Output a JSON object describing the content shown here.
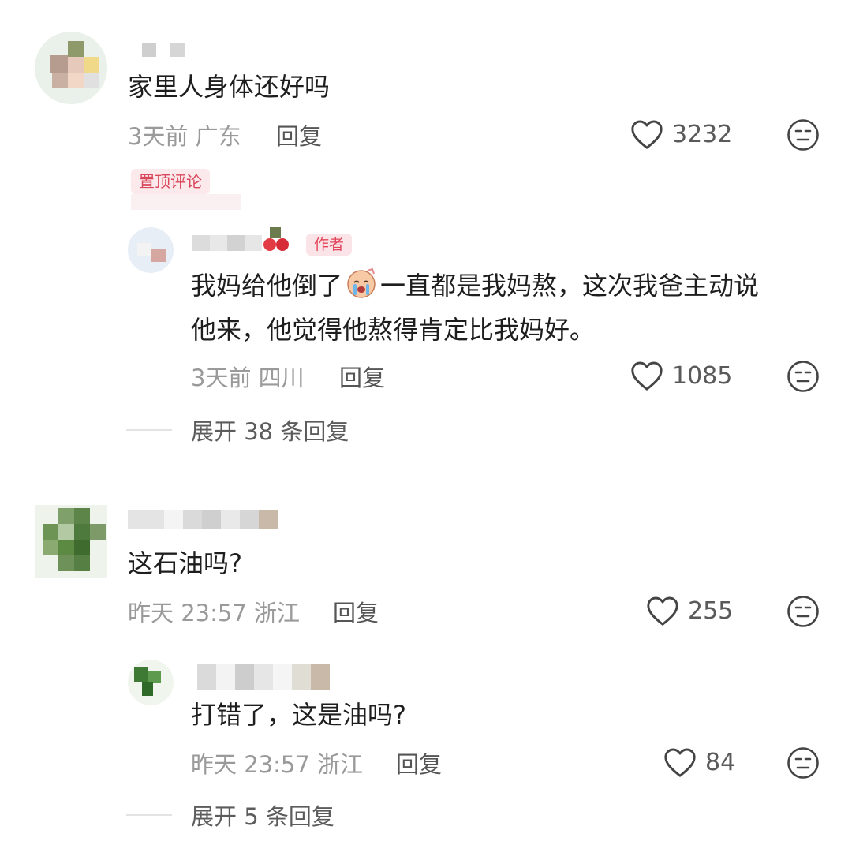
{
  "comments": [
    {
      "text": "家里人身体还好吗",
      "time": "3天前",
      "location": "广东",
      "reply_label": "回复",
      "likes": "3232",
      "pinned_label": "置顶评论"
    },
    {
      "text_line1_before": "我妈给他倒了",
      "text_line1_after": "一直都是我妈熬，这次我爸主动说",
      "text_line2": "他来，他觉得他熬得肯定比我妈好。",
      "author_badge": "作者",
      "time": "3天前",
      "location": "四川",
      "reply_label": "回复",
      "likes": "1085",
      "expand_label": "展开 38 条回复"
    },
    {
      "text": "这石油吗?",
      "time": "昨天 23:57",
      "location": "浙江",
      "reply_label": "回复",
      "likes": "255"
    },
    {
      "text": "打错了，这是油吗?",
      "time": "昨天 23:57",
      "location": "浙江",
      "reply_label": "回复",
      "likes": "84",
      "expand_label": "展开 5 条回复"
    }
  ],
  "icons": {
    "like": "heart-outline-icon",
    "dislike": "meh-face-icon",
    "emoji": "crying-face-emoji"
  },
  "colors": {
    "pinned_text": "#d9485a",
    "pinned_bg": "#fbe9ec",
    "meta_text": "#9a9a9a"
  }
}
